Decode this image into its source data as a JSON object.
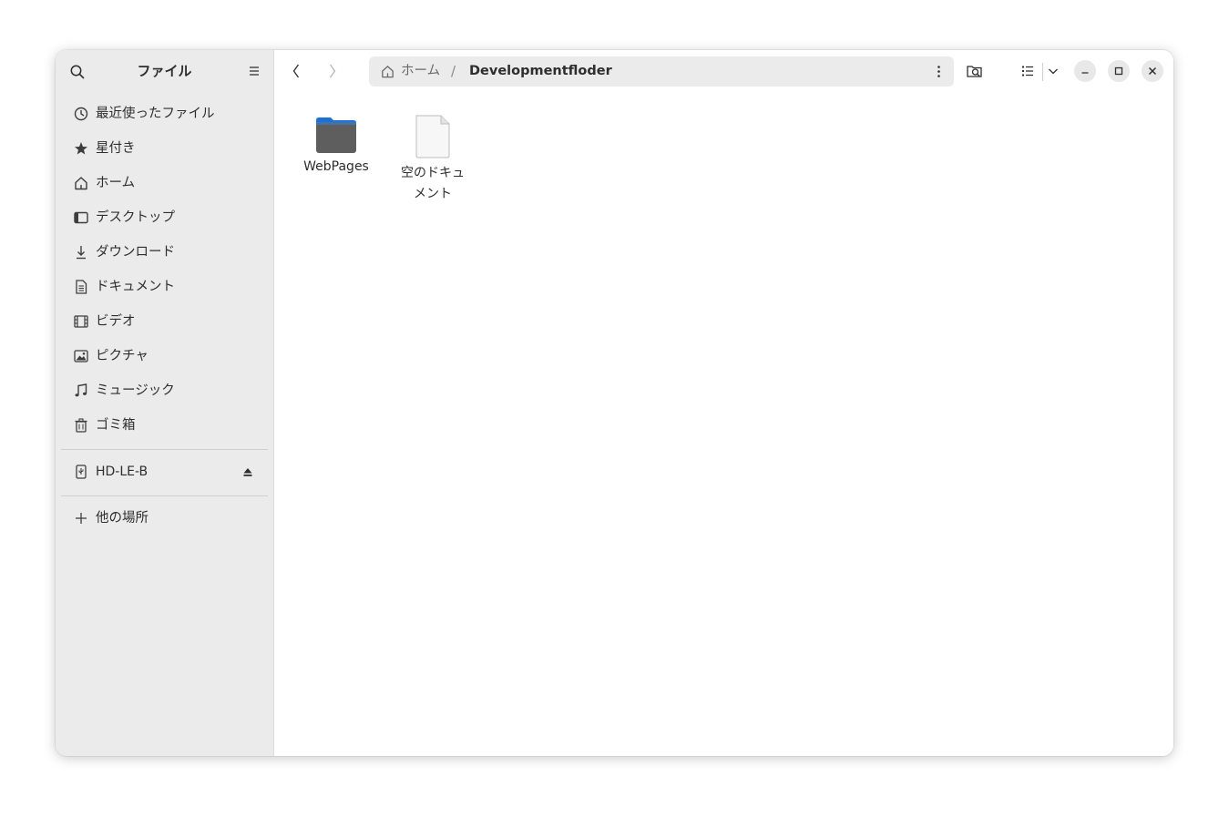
{
  "window": {
    "title": "ファイル"
  },
  "sidebar": {
    "items": [
      {
        "label": "最近使ったファイル",
        "icon": "clock-icon"
      },
      {
        "label": "星付き",
        "icon": "star-icon"
      },
      {
        "label": "ホーム",
        "icon": "home-icon"
      },
      {
        "label": "デスクトップ",
        "icon": "desktop-icon"
      },
      {
        "label": "ダウンロード",
        "icon": "download-icon"
      },
      {
        "label": "ドキュメント",
        "icon": "document-icon"
      },
      {
        "label": "ビデオ",
        "icon": "film-icon"
      },
      {
        "label": "ピクチャ",
        "icon": "picture-icon"
      },
      {
        "label": "ミュージック",
        "icon": "music-icon"
      },
      {
        "label": "ゴミ箱",
        "icon": "trash-icon"
      }
    ],
    "devices": [
      {
        "label": "HD-LE-B",
        "icon": "usb-drive-icon"
      }
    ],
    "other_locations": {
      "label": "他の場所",
      "icon": "plus-icon"
    }
  },
  "pathbar": {
    "home_label": "ホーム",
    "separator": "/",
    "current": "Developmentfloder"
  },
  "files": [
    {
      "name": "WebPages",
      "kind": "folder",
      "icon": "folder-icon"
    },
    {
      "name_line1": "空のドキュ",
      "name_line2": "メント",
      "kind": "file",
      "icon": "empty-document-icon"
    }
  ],
  "colors": {
    "accent": "#1c71d8",
    "folder_body": "#5e5e5e",
    "sidebar_bg": "#ebebeb"
  }
}
